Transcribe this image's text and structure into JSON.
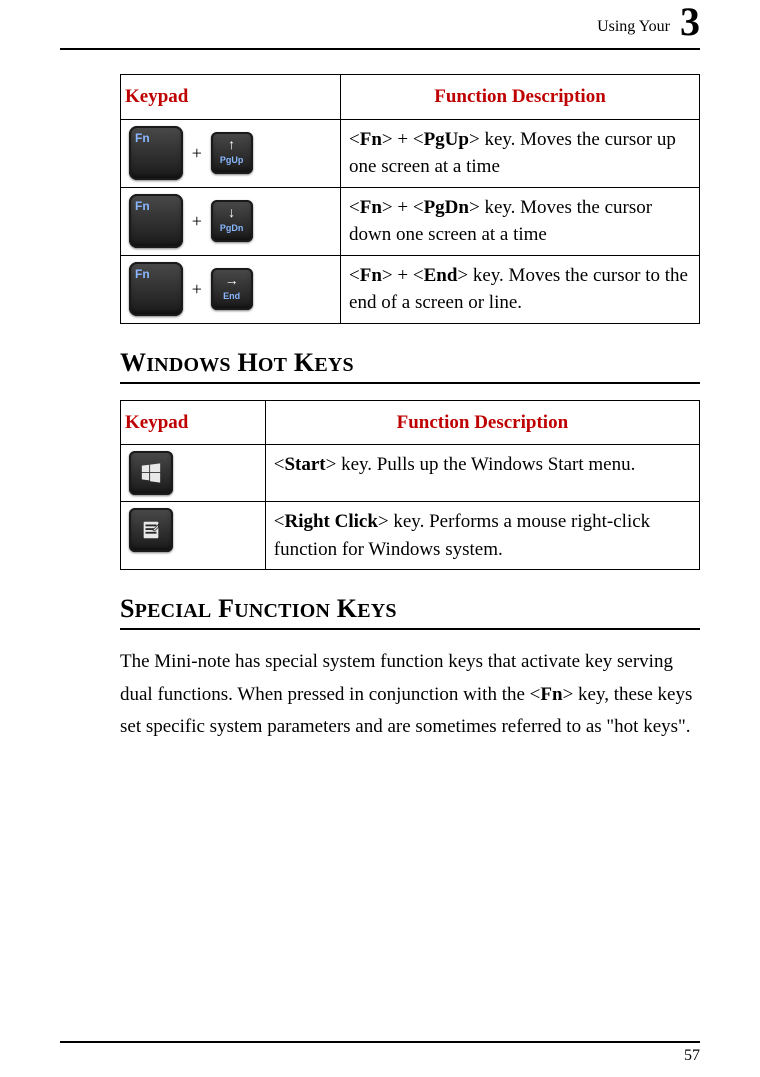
{
  "header": {
    "text": "Using Your",
    "chapter": "3"
  },
  "table1": {
    "head": {
      "keypad": "Keypad",
      "desc": "Function Description"
    },
    "rows": [
      {
        "fn": "Fn",
        "sub": "PgUp",
        "arrow": "↑",
        "desc_pre": "<",
        "k1": "Fn",
        "mid1": "> + <",
        "k2": "PgUp",
        "mid2": "> key. Moves the cursor up one screen at a time"
      },
      {
        "fn": "Fn",
        "sub": "PgDn",
        "arrow": "↓",
        "desc_pre": "<",
        "k1": "Fn",
        "mid1": "> + <",
        "k2": "PgDn",
        "mid2": "> key. Moves the cursor down one screen at a time"
      },
      {
        "fn": "Fn",
        "sub": "End",
        "arrow": "→",
        "desc_pre": "<",
        "k1": "Fn",
        "mid1": "> + <",
        "k2": "End",
        "mid2": "> key. Moves the cursor to the end of a screen or line."
      }
    ]
  },
  "section1": {
    "title_parts": [
      "W",
      "INDOWS",
      " H",
      "OT",
      " K",
      "EYS"
    ]
  },
  "table2": {
    "head": {
      "keypad": "Keypad",
      "desc": "Function Description"
    },
    "rows": [
      {
        "type": "win",
        "desc_pre": "<",
        "k1": "Start",
        "mid2": "> key. Pulls up the Windows Start menu."
      },
      {
        "type": "menu",
        "desc_pre": "<",
        "k1": "Right Click",
        "mid2": "> key. Performs a mouse right-click function for Windows system."
      }
    ]
  },
  "section2": {
    "title_parts": [
      "S",
      "PECIAL",
      " F",
      "UNCTION",
      " K",
      "EYS"
    ]
  },
  "para": {
    "t1": "The Mini-note has special system function keys that activate key serving dual functions. When pressed in conjunction with the <",
    "k": "Fn",
    "t2": "> key, these keys set specific system parameters and are sometimes referred to as \"hot keys\"."
  },
  "footer": {
    "page": "57"
  }
}
